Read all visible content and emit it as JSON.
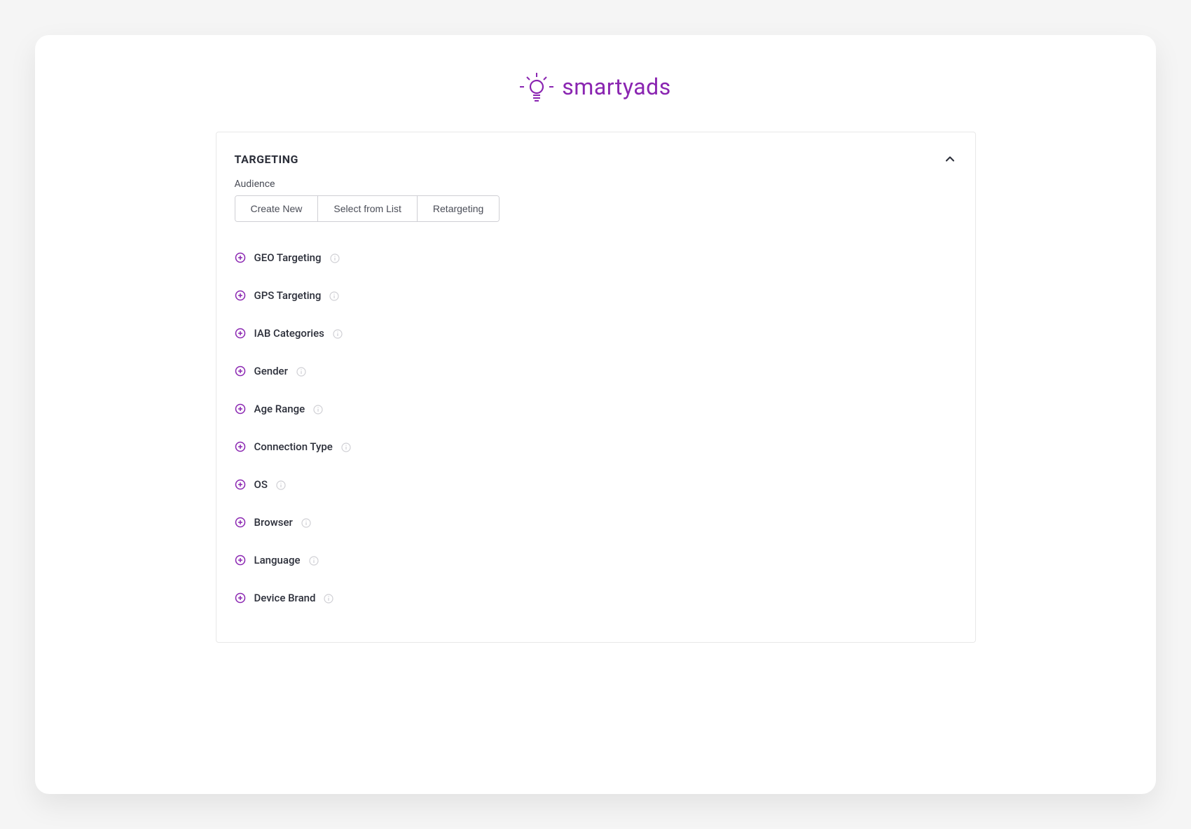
{
  "brand": {
    "name": "smartyads",
    "accent": "#8a25b1"
  },
  "panel": {
    "title": "TARGETING",
    "audience_label": "Audience",
    "buttons": {
      "create_new": "Create New",
      "select_from_list": "Select from List",
      "retargeting": "Retargeting"
    },
    "items": [
      {
        "label": "GEO Targeting"
      },
      {
        "label": "GPS Targeting"
      },
      {
        "label": "IAB Categories"
      },
      {
        "label": "Gender"
      },
      {
        "label": "Age Range"
      },
      {
        "label": "Connection Type"
      },
      {
        "label": "OS"
      },
      {
        "label": "Browser"
      },
      {
        "label": "Language"
      },
      {
        "label": "Device Brand"
      }
    ]
  }
}
